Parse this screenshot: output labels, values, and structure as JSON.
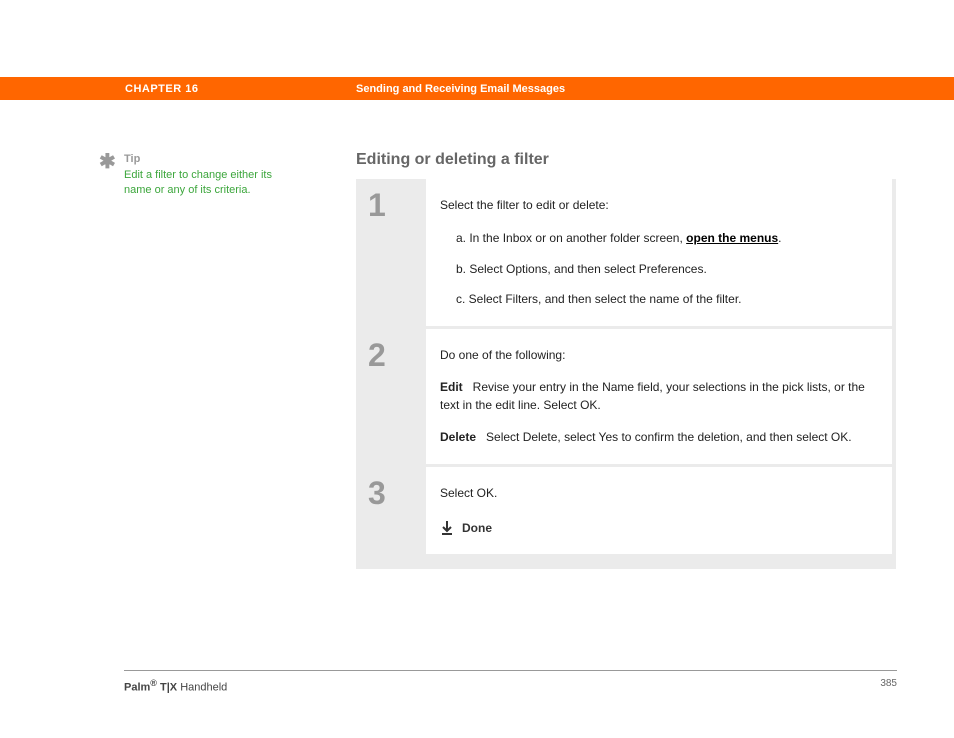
{
  "header": {
    "chapter": "CHAPTER 16",
    "title": "Sending and Receiving Email Messages"
  },
  "tip": {
    "asterisk": "✱",
    "label": "Tip",
    "text": "Edit a filter to change either its name or any of its criteria."
  },
  "section": {
    "title": "Editing or deleting a filter"
  },
  "steps": {
    "s1": {
      "num": "1",
      "intro": "Select the filter to edit or delete:",
      "a_prefix": "a.   In the Inbox or on another folder screen, ",
      "a_link": "open the menus",
      "a_suffix": ".",
      "b": "b.   Select Options, and then select Preferences.",
      "c": "c.   Select Filters, and then select the name of the filter."
    },
    "s2": {
      "num": "2",
      "intro": "Do one of the following:",
      "edit_label": "Edit",
      "edit_text": "Revise your entry in the Name field, your selections in the pick lists, or the text in the edit line. Select OK.",
      "delete_label": "Delete",
      "delete_text": "Select Delete, select Yes to confirm the deletion, and then select OK."
    },
    "s3": {
      "num": "3",
      "intro": "Select OK.",
      "done": "Done"
    }
  },
  "footer": {
    "brand1": "Palm",
    "reg": "®",
    "brand2": " T|X",
    "tail": " Handheld",
    "page": "385"
  }
}
